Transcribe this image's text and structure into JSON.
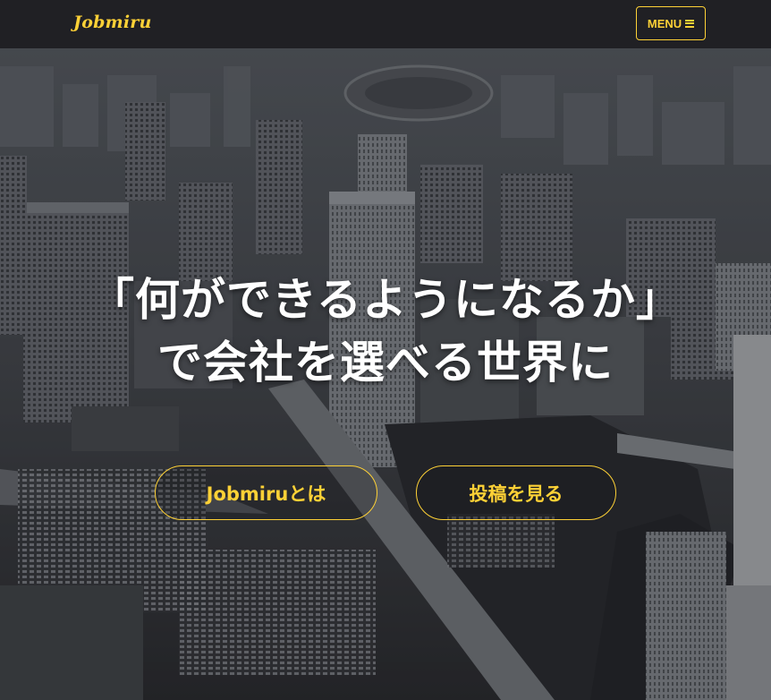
{
  "navbar": {
    "brand": "Jobmiru",
    "menu_label": "MENU",
    "menu_icon": "hamburger-icon"
  },
  "hero": {
    "headline_line1": "「何ができるようになるか」",
    "headline_line2": "で会社を選べる世界に",
    "background_image": "aerial-city-photo"
  },
  "buttons": {
    "about_label": "Jobmiruとは",
    "posts_label": "投稿を見る"
  },
  "colors": {
    "accent": "#fed136",
    "navbar_bg": "#202024",
    "headline": "#ffffff"
  }
}
